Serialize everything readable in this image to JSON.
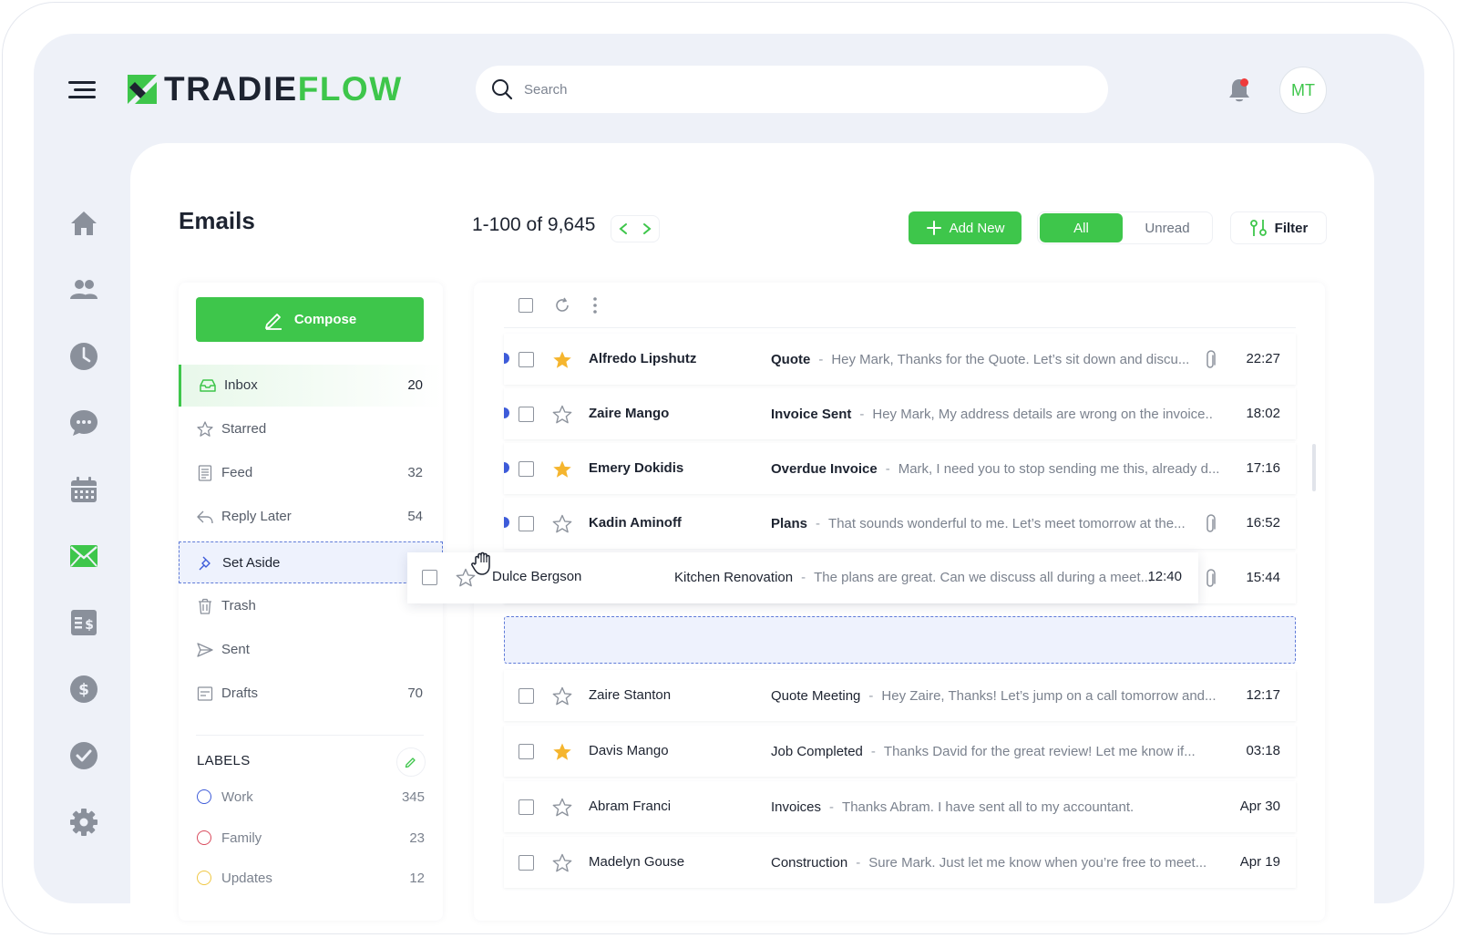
{
  "brand": {
    "name_part1": "TRADIE",
    "name_part2": "FLOW",
    "accent": "#3ec64b"
  },
  "search": {
    "placeholder": "Search",
    "value": ""
  },
  "header": {
    "avatar_initials": "MT"
  },
  "nav_icons": [
    "home-icon",
    "users-icon",
    "clock-icon",
    "chat-icon",
    "calendar-icon",
    "mail-icon",
    "invoice-icon",
    "dollar-icon",
    "check-icon",
    "gear-icon"
  ],
  "page": {
    "title": "Emails",
    "pagination": "1-100 of 9,645",
    "add_new_label": "Add New",
    "filter_all_label": "All",
    "filter_unread_label": "Unread",
    "filter_label": "Filter"
  },
  "compose_label": "Compose",
  "folders": [
    {
      "label": "Inbox",
      "count": "20"
    },
    {
      "label": "Starred",
      "count": ""
    },
    {
      "label": "Feed",
      "count": "32"
    },
    {
      "label": "Reply Later",
      "count": "54"
    },
    {
      "label": "Set Aside",
      "count": ""
    },
    {
      "label": "Trash",
      "count": ""
    },
    {
      "label": "Sent",
      "count": ""
    },
    {
      "label": "Drafts",
      "count": "70"
    }
  ],
  "labels_section": {
    "title": "LABELS",
    "items": [
      {
        "label": "Work",
        "count": "345",
        "color": "#3d5bd9"
      },
      {
        "label": "Family",
        "count": "23",
        "color": "#d94a5c"
      },
      {
        "label": "Updates",
        "count": "12",
        "color": "#f0c742"
      }
    ]
  },
  "emails": [
    {
      "sender": "Alfredo Lipshutz",
      "subject": "Quote",
      "preview": "Hey Mark, Thanks for the Quote. Let’s sit down and discu...",
      "time": "22:27"
    },
    {
      "sender": "Zaire Mango",
      "subject": "Invoice Sent",
      "preview": "Hey Mark, My address details are wrong on the invoice..",
      "time": "18:02"
    },
    {
      "sender": "Emery Dokidis",
      "subject": "Overdue Invoice",
      "preview": "Mark, I need you to stop sending me this, already d...",
      "time": "17:16"
    },
    {
      "sender": "Kadin Aminoff",
      "subject": "Plans",
      "preview": "That sounds wonderful to me. Let’s meet tomorrow at the...",
      "time": "16:52"
    },
    {
      "sender": "",
      "subject": "",
      "preview": "",
      "time": "15:44"
    },
    {
      "sender": "Zaire Stanton",
      "subject": "Quote Meeting",
      "preview": "Hey Zaire, Thanks! Let’s jump on a call tomorrow and...",
      "time": "12:17"
    },
    {
      "sender": "Davis Mango",
      "subject": "Job Completed",
      "preview": "Thanks David for the great review! Let me know if...",
      "time": "03:18"
    },
    {
      "sender": "Abram Franci",
      "subject": "Invoices",
      "preview": "Thanks Abram. I have sent all to my accountant.",
      "time": "Apr 30"
    },
    {
      "sender": "Madelyn Gouse",
      "subject": "Construction",
      "preview": "Sure Mark. Just let me know when you’re free to meet...",
      "time": "Apr 19"
    }
  ],
  "dragged_email": {
    "sender": "Dulce Bergson",
    "subject": "Kitchen Renovation",
    "preview": "The plans are great. Can we discuss all during a meet...",
    "time": "12:40"
  }
}
